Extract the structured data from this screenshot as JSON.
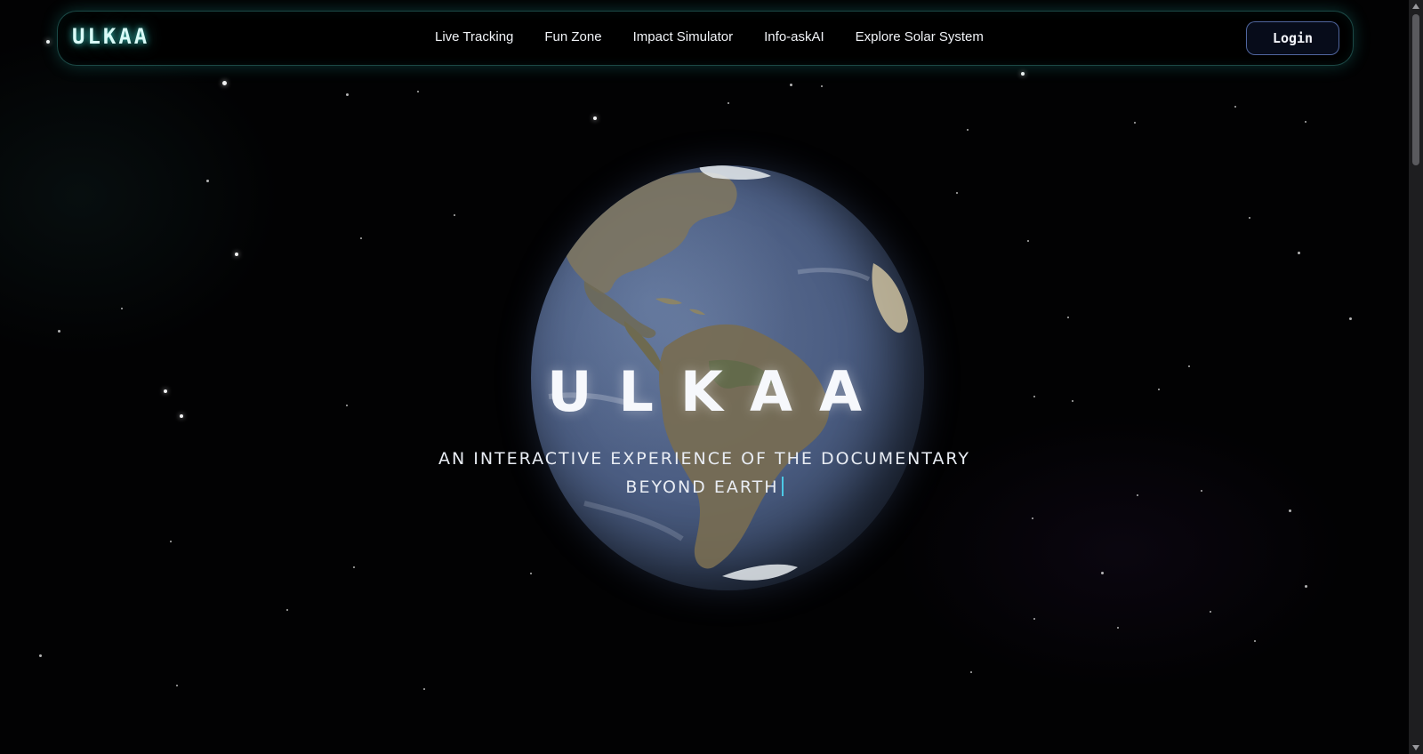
{
  "navbar": {
    "brand": "ULKAA",
    "links": [
      "Live Tracking",
      "Fun Zone",
      "Impact Simulator",
      "Info-askAI",
      "Explore Solar System"
    ],
    "login_label": "Login"
  },
  "hero": {
    "title": "ULKAA",
    "subtitle_line1": "AN INTERACTIVE EXPERIENCE OF THE DOCUMENTARY",
    "subtitle_line2": "BEYOND EARTH"
  },
  "colors": {
    "background": "#000000",
    "accent_glow": "#3cdcd2",
    "cursor": "#4cc9e6",
    "login_border": "#7896e6"
  },
  "icons": [
    "earth-globe"
  ]
}
